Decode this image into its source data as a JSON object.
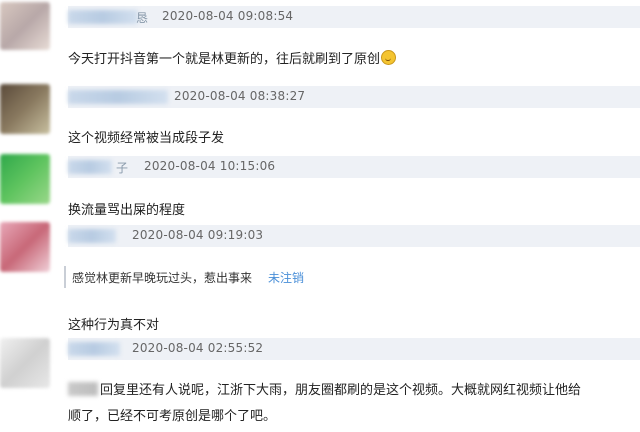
{
  "comments": [
    {
      "name_suffix": "恳",
      "timestamp": "2020-08-04 09:08:54",
      "text": "今天打开抖音第一个就是林更新的，往后就刷到了原创",
      "emoji": "smile-emoji"
    },
    {
      "name_suffix": "",
      "timestamp": "2020-08-04 08:38:27",
      "text": "这个视频经常被当成段子发"
    },
    {
      "name_suffix": "子",
      "timestamp": "2020-08-04 10:15:06",
      "text": "换流量骂出屎的程度"
    },
    {
      "name_suffix": "",
      "timestamp": "2020-08-04 09:19:03",
      "reply": {
        "text": "感觉林更新早晚玩过头，惹出事来",
        "action": "未注销"
      },
      "text": "这种行为真不对"
    },
    {
      "name_suffix": "",
      "timestamp": "2020-08-04 02:55:52",
      "text_line1": "回复里还有人说呢，江浙下大雨，朋友圈都刷的是这个视频。大概就网红视频让他给",
      "text_line2": "顺了，已经不可考原创是哪个了吧。"
    }
  ],
  "colors": {
    "header_bg": "#eef1f6",
    "link_blue": "#4a8fd8"
  }
}
